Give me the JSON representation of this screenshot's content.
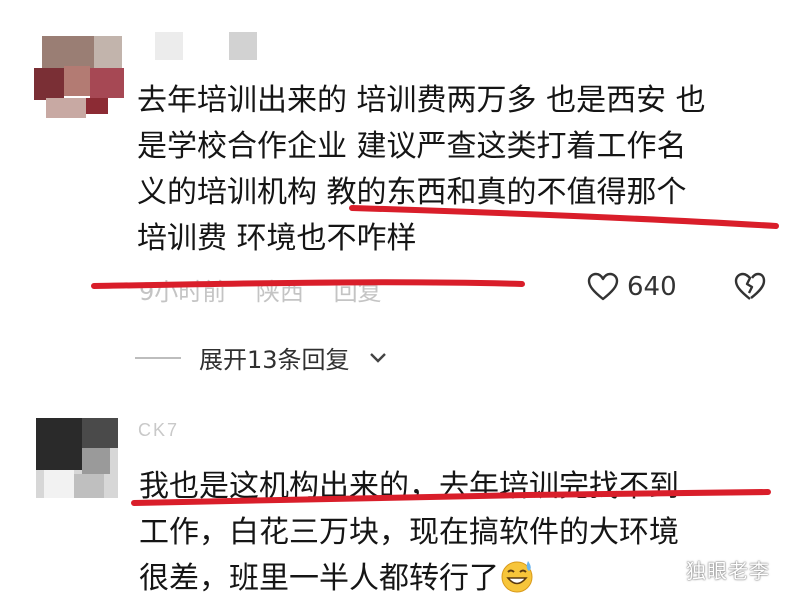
{
  "comments": [
    {
      "avatar": "blurred-avatar",
      "text_lines": [
        "去年培训出来的 培训费两万多 也是西安 也",
        "是学校合作企业 建议严查这类打着工作名",
        "义的培训机构 教的东西和真的不值得那个",
        "培训费 环境也不咋样"
      ],
      "meta": {
        "time": "9小时前",
        "location": "陕西",
        "reply_label": "回复"
      },
      "likes": "640",
      "like_icon": "heart-outline-icon",
      "dislike_icon": "broken-heart-icon",
      "expand_label": "展开13条回复",
      "expand_icon": "chevron-down-icon"
    },
    {
      "username": "CK7",
      "avatar": "blurred-avatar",
      "text_lines": [
        "我也是这机构出来的，去年培训完找不到",
        "工作，白花三万块，现在搞软件的大环境",
        "很差，班里一半人都转行了"
      ],
      "emoji": "grinning-sweat-emoji"
    }
  ],
  "annotation_color": "#d91e2a",
  "watermark": "独眼老李"
}
